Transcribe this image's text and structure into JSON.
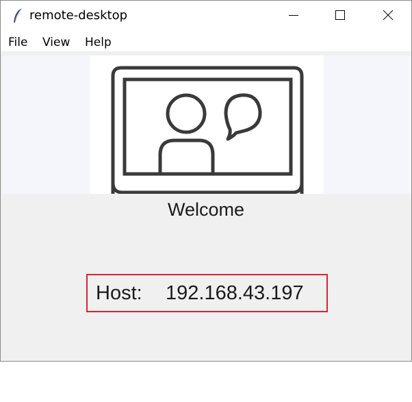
{
  "window": {
    "title": "remote-desktop",
    "app_icon": "feather-icon",
    "controls": {
      "minimize_icon": "minimize-icon",
      "maximize_icon": "maximize-icon",
      "close_icon": "close-icon"
    }
  },
  "menubar": {
    "items": [
      {
        "label": "File"
      },
      {
        "label": "View"
      },
      {
        "label": "Help"
      }
    ]
  },
  "main": {
    "illustration_icon": "video-chat-icon",
    "welcome": "Welcome",
    "host": {
      "label": "Host:",
      "value": "192.168.43.197",
      "highlight_color": "#e0202c"
    }
  }
}
